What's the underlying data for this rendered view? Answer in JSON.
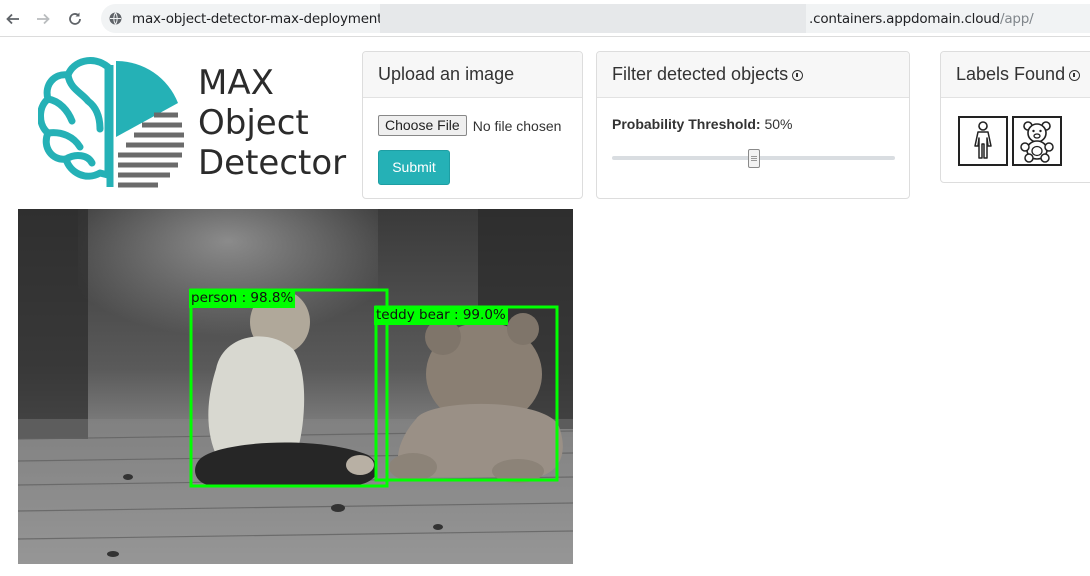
{
  "browser": {
    "back_icon": "arrow-left-icon",
    "forward_icon": "arrow-right-icon",
    "reload_icon": "reload-icon",
    "site_icon": "globe-icon",
    "url_host": "max-object-detector-max-deployments.",
    "url_suffix": ".containers.appdomain.cloud",
    "url_path": "/app/"
  },
  "logo": {
    "line1": "MAX",
    "line2": "Object",
    "line3": "Detector",
    "accent_color": "#25b1b6"
  },
  "upload": {
    "title": "Upload an image",
    "choose_label": "Choose File",
    "file_status": "No file chosen",
    "submit_label": "Submit"
  },
  "filter": {
    "title": "Filter detected objects",
    "threshold_label": "Probability Threshold:",
    "threshold_value": "50%",
    "threshold_fraction": 0.5
  },
  "labels": {
    "title": "Labels Found",
    "items": [
      {
        "icon": "person-icon"
      },
      {
        "icon": "teddy-bear-icon"
      }
    ]
  },
  "detections": [
    {
      "label": "person : 98.8%",
      "color": "#00ff00"
    },
    {
      "label": "teddy bear : 99.0%",
      "color": "#00ff00"
    }
  ],
  "colors": {
    "accent": "#25b1b6",
    "box": "#00ff00"
  }
}
